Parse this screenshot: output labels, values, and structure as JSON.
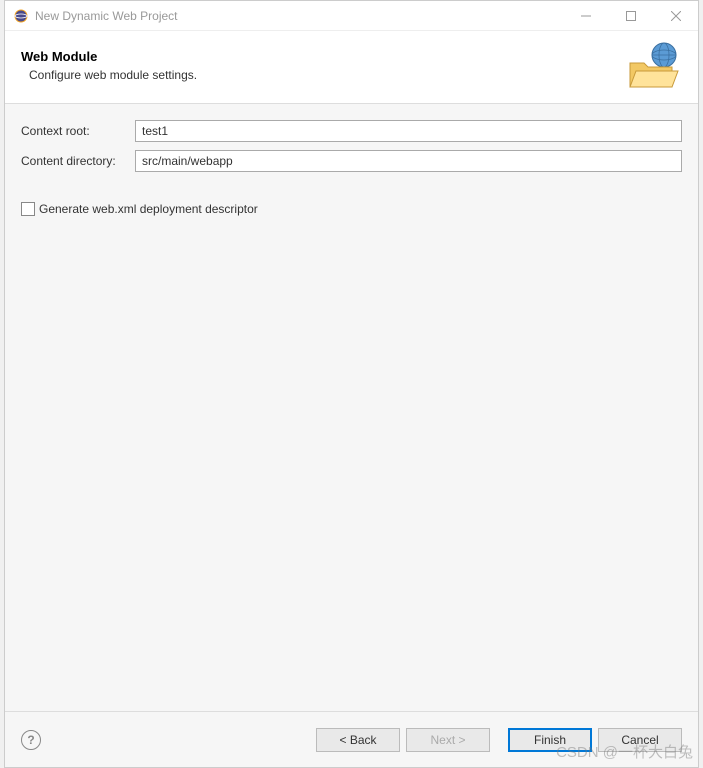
{
  "titlebar": {
    "title": "New Dynamic Web Project"
  },
  "header": {
    "title": "Web Module",
    "subtitle": "Configure web module settings."
  },
  "form": {
    "contextRoot": {
      "label": "Context root:",
      "value": "test1"
    },
    "contentDirectory": {
      "label": "Content directory:",
      "value": "src/main/webapp"
    },
    "generateWebXml": {
      "label": "Generate web.xml deployment descriptor",
      "checked": false
    }
  },
  "footer": {
    "back": "< Back",
    "next": "Next >",
    "finish": "Finish",
    "cancel": "Cancel"
  },
  "watermark": "CSDN @一杯大白兔"
}
